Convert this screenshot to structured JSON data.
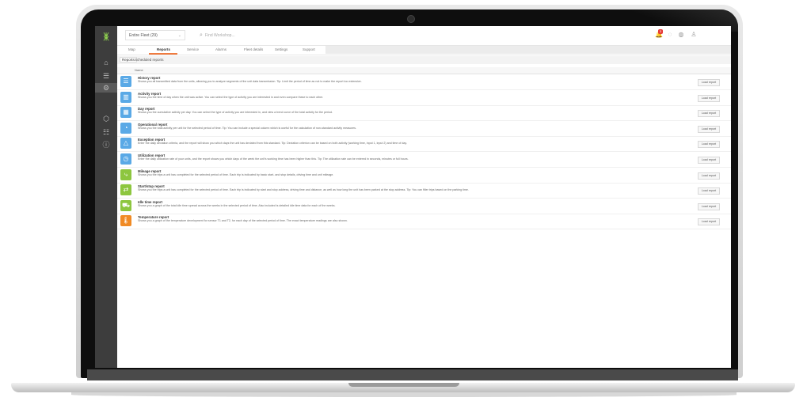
{
  "app": {
    "fleet_select": "Entire Fleet (29)",
    "search_placeholder": "Find Workshop...",
    "notification_count": "3"
  },
  "nav": {
    "tabs": [
      "Map",
      "Reports",
      "Service",
      "Alarms",
      "Fleet details",
      "Settings",
      "Support"
    ]
  },
  "subtabs": [
    "Reports",
    "Scheduled reports"
  ],
  "table": {
    "column_name": "Name"
  },
  "reports": [
    {
      "title": "History report",
      "desc": "Shows you all transmitted data from the units, allowing you to analyze segments of the unit data transmission.\nTip: Limit the period of time as not to make the report too extensive.",
      "icon": "history-icon",
      "glyph": "☰",
      "color": "#5aa9e6",
      "button": "Load report"
    },
    {
      "title": "Activity report",
      "desc": "Shows you the time of day when the unit was active. You can select the type of activity you are interested in and even compare these to each other.",
      "icon": "activity-icon",
      "glyph": "▥",
      "color": "#5aa9e6",
      "button": "Load report"
    },
    {
      "title": "Day report",
      "desc": "Shows you the cumulative activity per day. You can select the type of activity you are interested in, and view a trend curve of the total activity for the period.",
      "icon": "calendar-icon",
      "glyph": "▦",
      "color": "#5aa9e6",
      "button": "Load report"
    },
    {
      "title": "Operational report",
      "desc": "Shows you the total activity per unit for the selected period of time.\nTip: You can include a special column which is useful for the calculation of non-standard activity measures.",
      "icon": "pie-chart-icon",
      "glyph": "◔",
      "color": "#5aa9e6",
      "button": "Load report"
    },
    {
      "title": "Exception report",
      "desc": "Enter the daily deviation criteria, and the report will show you which days the unit has deviated from this standard.\nTip: Deviation criterion can be based on both activity (working time, input 1, input 2) and time of day.",
      "icon": "warning-icon",
      "glyph": "△",
      "color": "#5aa9e6",
      "button": "Load report"
    },
    {
      "title": "Utilization report",
      "desc": "Enter the daily utilization rate of your units, and the report shows you which days of the week the unit's working time has been higher than this.\nTip: The utilization rate can be entered in seconds, minutes or full hours.",
      "icon": "gauge-icon",
      "glyph": "◷",
      "color": "#5aa9e6",
      "button": "Load report"
    },
    {
      "title": "Mileage report",
      "desc": "Shows you the trips a unit has completed for the selected period of time. Each trip is indicated by basic start- and stop details, driving time and unit mileage.",
      "icon": "route-icon",
      "glyph": "⤷",
      "color": "#8dc63f",
      "button": "Load report"
    },
    {
      "title": "Start/stop report",
      "desc": "Shows you the trips a unit has completed for the selected period of time. Each trip is indicated by start and stop address, driving time and distance, as well as how long the unit has been parked at the stop address.\nTip: You can filter trips based on the parking time.",
      "icon": "start-stop-icon",
      "glyph": "⇄",
      "color": "#8dc63f",
      "button": "Load report"
    },
    {
      "title": "Idle time report",
      "desc": "Shows you a graph of the total idle time spread across the weeks in the selected period of time. Also included is detailed idle time data for each of the weeks.",
      "icon": "truck-icon",
      "glyph": "⛟",
      "color": "#8dc63f",
      "button": "Load report"
    },
    {
      "title": "Temperature report",
      "desc": "Shows you a graph of the temperature development for sensor T1 and T2, for each day of the selected period of time. The exact temperature readings are also shown.",
      "icon": "thermometer-icon",
      "glyph": "🌡",
      "color": "#f08a24",
      "button": "Load report"
    }
  ]
}
